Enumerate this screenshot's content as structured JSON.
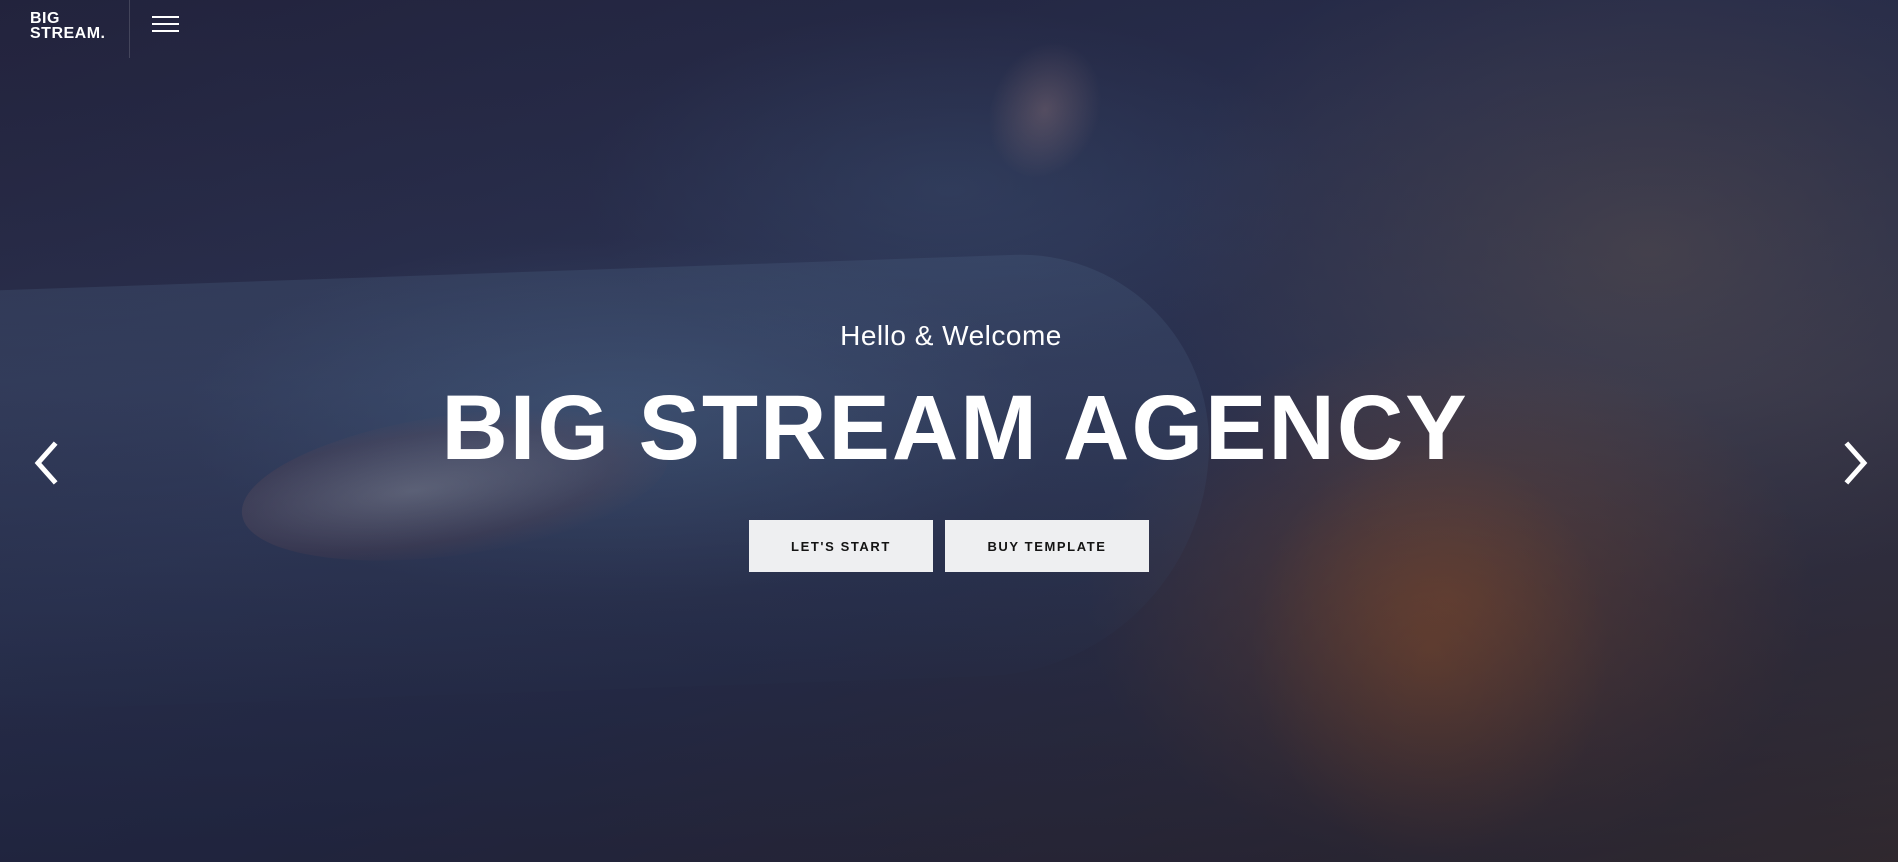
{
  "header": {
    "logo_line1": "BIG",
    "logo_line2": "STREAM."
  },
  "hero": {
    "subtitle": "Hello & Welcome",
    "title": "BIG STREAM AGENCY",
    "primary_button": "LET'S START",
    "secondary_button": "BUY TEMPLATE"
  },
  "icons": {
    "menu": "hamburger-menu-icon",
    "prev": "chevron-left-icon",
    "next": "chevron-right-icon"
  },
  "colors": {
    "text": "#ffffff",
    "button_bg": "#eeeff1",
    "button_text": "#141414",
    "background": "#1b1d33"
  }
}
